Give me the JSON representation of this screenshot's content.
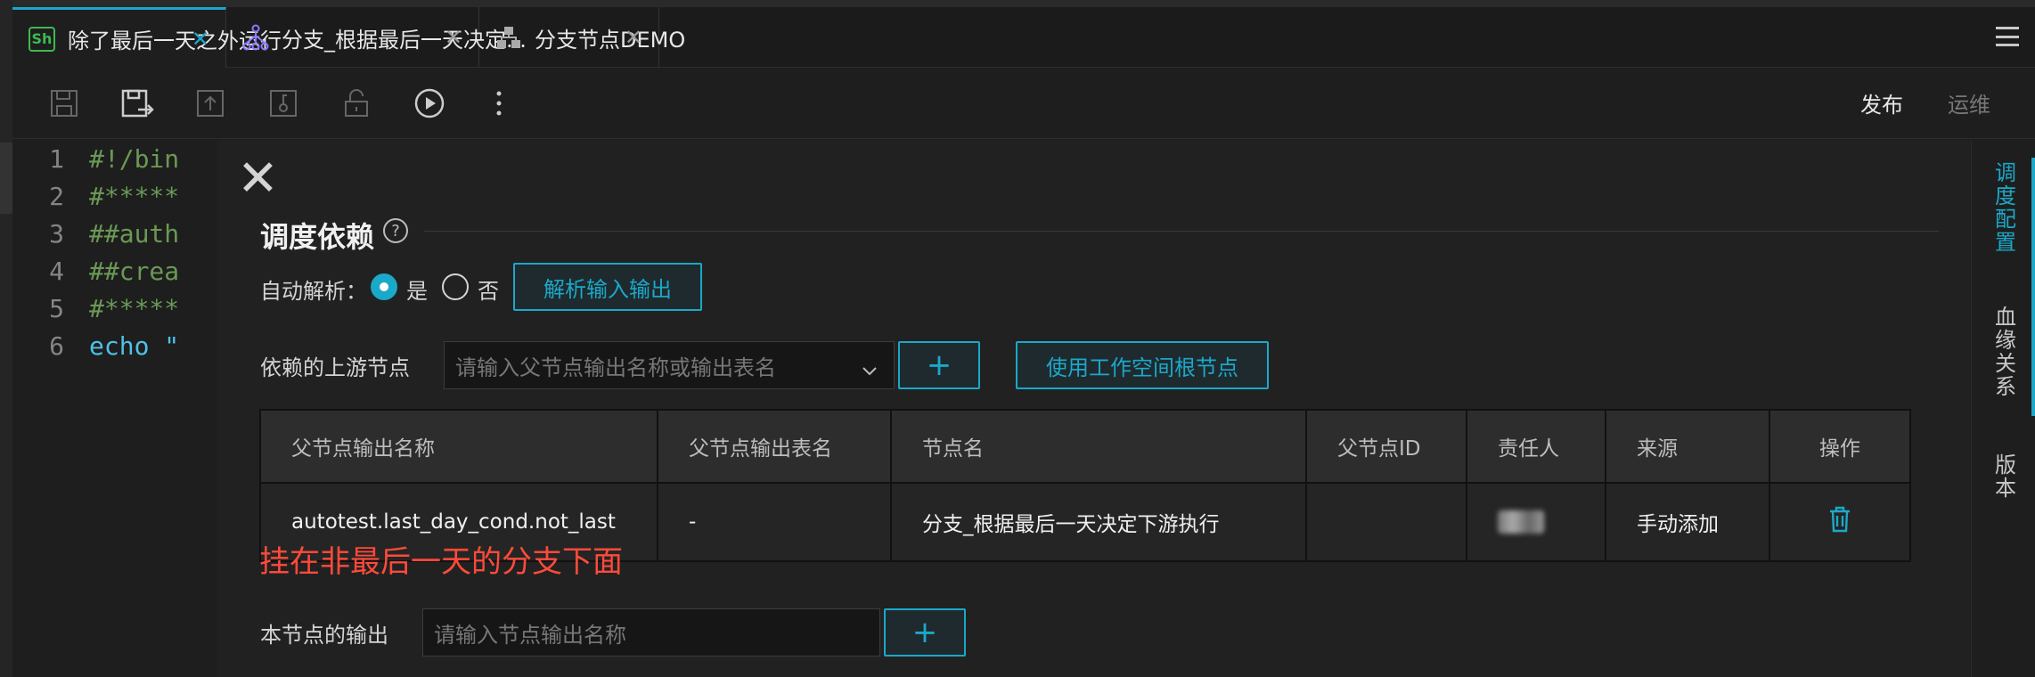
{
  "tabs": [
    {
      "label": "除了最后一天之外运行",
      "icon": "shell-script-icon",
      "badge": "Sh",
      "active": true
    },
    {
      "label": "分支_根据最后一天决定...",
      "icon": "branch-node-icon",
      "active": false
    },
    {
      "label": "分支节点DEMO",
      "icon": "workflow-icon",
      "active": false
    }
  ],
  "toolbar": {
    "publish_label": "发布",
    "ops_label": "运维"
  },
  "editor": {
    "lines": [
      {
        "num": "1",
        "text": "#!/bin"
      },
      {
        "num": "2",
        "text": "#*****"
      },
      {
        "num": "3",
        "text": "##auth"
      },
      {
        "num": "4",
        "text": "##crea"
      },
      {
        "num": "5",
        "text": "#*****"
      },
      {
        "num": "6",
        "text": "echo \""
      }
    ]
  },
  "sidebar": {
    "items": [
      {
        "label": "调度配置",
        "active": true
      },
      {
        "label": "血缘关系",
        "active": false
      },
      {
        "label": "版本",
        "active": false
      }
    ]
  },
  "panel": {
    "close_symbol": "✕",
    "section_title": "调度依赖",
    "help_symbol": "?",
    "auto_parse_label": "自动解析：",
    "option_yes": "是",
    "option_no": "否",
    "parse_button": "解析输入输出",
    "upstream_label": "依赖的上游节点",
    "upstream_placeholder": "请输入父节点输出名称或输出表名",
    "add_symbol": "+",
    "workspace_root_button": "使用工作空间根节点",
    "table": {
      "headers": [
        "父节点输出名称",
        "父节点输出表名",
        "节点名",
        "父节点ID",
        "责任人",
        "来源",
        "操作"
      ],
      "rows": [
        {
          "output_name": "autotest.last_day_cond.not_last",
          "output_table": "-",
          "node_name": "分支_根据最后一天决定下游执行",
          "node_id": "",
          "source": "手动添加"
        }
      ]
    },
    "annotation": "挂在非最后一天的分支下面",
    "output_label": "本节点的输出",
    "output_placeholder": "请输入节点输出名称"
  },
  "colors": {
    "accent": "#1ba8c9",
    "annotation": "#ff4a3a",
    "shell_badge": "#3fb950",
    "branch_icon": "#8a7cff"
  }
}
